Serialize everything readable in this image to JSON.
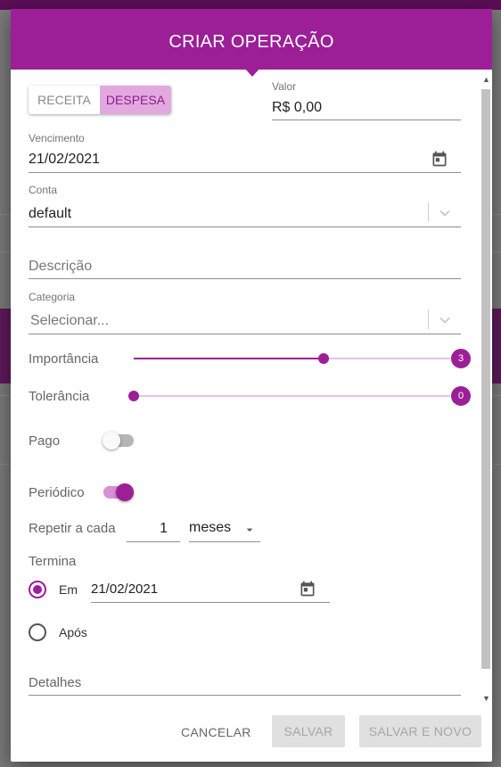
{
  "dialog": {
    "title": "CRIAR OPERAÇÃO"
  },
  "type_toggle": {
    "receita_label": "RECEITA",
    "despesa_label": "DESPESA",
    "selected": "DESPESA"
  },
  "valor": {
    "label": "Valor",
    "value": "R$ 0,00"
  },
  "vencimento": {
    "label": "Vencimento",
    "value": "21/02/2021"
  },
  "conta": {
    "label": "Conta",
    "value": "default"
  },
  "descricao": {
    "placeholder": "Descrição"
  },
  "categoria": {
    "label": "Categoria",
    "placeholder": "Selecionar..."
  },
  "importancia": {
    "label": "Importância",
    "value": 3,
    "badge": "3",
    "min": 0,
    "max": 5
  },
  "tolerancia": {
    "label": "Tolerância",
    "value": 0,
    "badge": "0",
    "min": 0,
    "max": 5
  },
  "pago": {
    "label": "Pago",
    "checked": false
  },
  "periodico": {
    "label": "Periódico",
    "checked": true
  },
  "repetir": {
    "label": "Repetir a cada",
    "value": "1",
    "unit": "meses"
  },
  "termina": {
    "label": "Termina",
    "em_label": "Em",
    "em_date": "21/02/2021",
    "apos_label": "Após",
    "selected": "Em"
  },
  "detalhes": {
    "placeholder": "Detalhes"
  },
  "actions": {
    "cancel_label": "CANCELAR",
    "save_label": "SALVAR",
    "save_new_label": "SALVAR E NOVO"
  },
  "colors": {
    "primary": "#9c1f98",
    "primary_light": "#e2a9df",
    "track_light": "#e3c2e2"
  }
}
